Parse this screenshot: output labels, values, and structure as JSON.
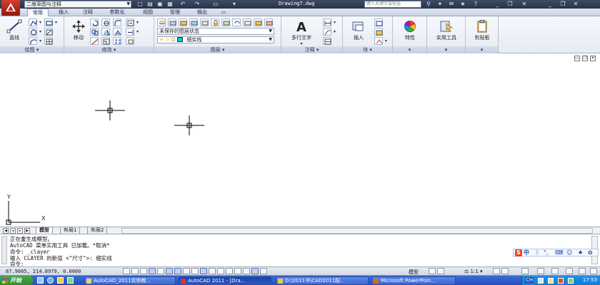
{
  "window": {
    "workspace": "二维草图与注释",
    "document_title": "Drawing7.dwg",
    "search_placeholder": "键入关键字或短语"
  },
  "ribbon_tabs": [
    "常用",
    "插入",
    "注释",
    "参数化",
    "视图",
    "管理",
    "输出"
  ],
  "active_tab": "常用",
  "panels": {
    "draw": {
      "title": "绘图",
      "line_label": "直线"
    },
    "modify": {
      "title": "修改",
      "move_label": "移动"
    },
    "layers": {
      "title": "图层",
      "layer_state": "未保存的图层状态",
      "current_layer": "细实线",
      "layer_color": "#00c8c8"
    },
    "annotation": {
      "title": "注释",
      "mtext_label": "多行文字"
    },
    "block": {
      "title": "块",
      "insert_label": "插入"
    },
    "properties": {
      "title": "特性"
    },
    "utilities": {
      "title": "实用工具"
    },
    "clipboard": {
      "title": "剪贴板"
    }
  },
  "ucs": {
    "x_label": "X",
    "y_label": "Y"
  },
  "layout_tabs": [
    "模型",
    "布局1",
    "布局2"
  ],
  "active_layout": "模型",
  "command_history": [
    "正在重生成模型。",
    "AutoCAD 菜单实用工具 已加载。*取消*",
    "命令: _clayer",
    "输入 CLAYER 的新值 <\"尺寸\">: 细实线"
  ],
  "command_prompt": "命令:",
  "ime": {
    "logo": "S",
    "mode": "中"
  },
  "status": {
    "coordinates": "87.9005, 214.8979, 0.0000",
    "space": "模型",
    "annotation_scale": "1:1"
  },
  "taskbar": {
    "start_label": "开始",
    "tasks": [
      {
        "label": "AutoCAD_2011实例教...",
        "active": false,
        "color": "#e8d27a"
      },
      {
        "label": "AutoCAD 2011 - [Dra...",
        "active": true,
        "color": "#d33a2a"
      },
      {
        "label": "D:\\2011书\\CAD2011配...",
        "active": false,
        "color": "#f1c74a"
      },
      {
        "label": "Microsoft PowerPoin...",
        "active": false,
        "color": "#d9672c"
      }
    ],
    "tray_lang": "CH",
    "clock": "17:53"
  }
}
